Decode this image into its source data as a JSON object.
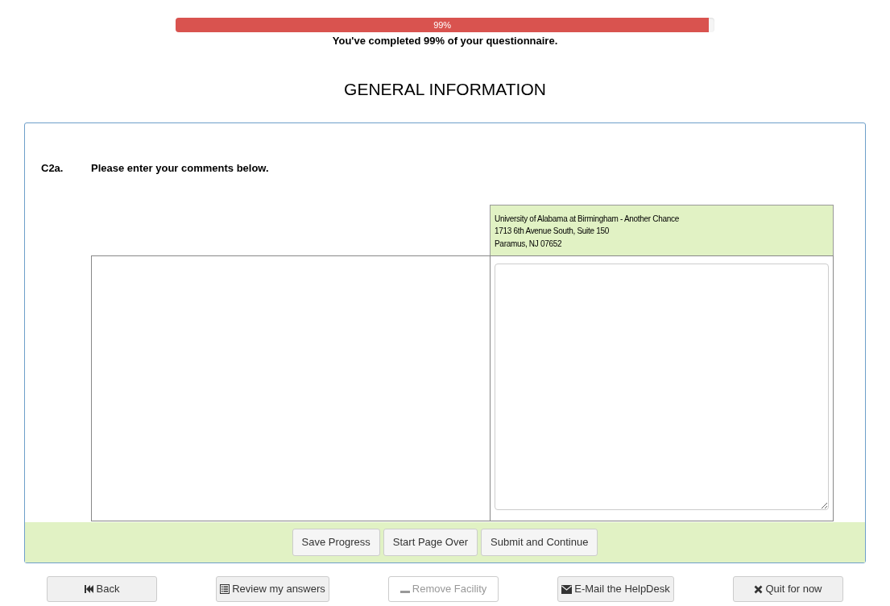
{
  "progress": {
    "level": 0.99,
    "label": "99%",
    "message": "You've completed 99% of your questionnaire."
  },
  "section_title": "GENERAL INFORMATION",
  "question": {
    "number": "C2a.",
    "text": "Please enter your comments below."
  },
  "facility": {
    "lines": [
      "University of Alabama at Birmingham - Another Chance",
      "1713 6th Avenue South, Suite 150",
      "Paramus, NJ 07652"
    ]
  },
  "form_buttons": [
    "Save Progress",
    "Start Page Over",
    "Submit and Continue"
  ],
  "nav_buttons": [
    {
      "kind": "back",
      "label": "Back",
      "disabled": false
    },
    {
      "kind": "review",
      "label": "Review my answers",
      "disabled": false
    },
    {
      "kind": "remove",
      "label": "Remove Facility",
      "disabled": true
    },
    {
      "kind": "email",
      "label": "E-Mail the HelpDesk",
      "disabled": false
    },
    {
      "kind": "quit",
      "label": "Quit for now",
      "disabled": false
    }
  ]
}
